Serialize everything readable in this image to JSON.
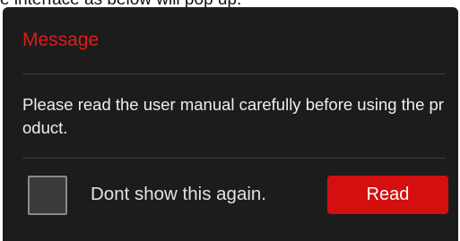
{
  "background_text": "e interface as below will pop up.",
  "dialog": {
    "title": "Message",
    "body": "Please read the user manual carefully before using the product.",
    "checkbox": {
      "label": "Dont show this again.",
      "checked": false
    },
    "read_button_label": "Read"
  },
  "colors": {
    "dialog_background": "#1c1c1c",
    "title": "#e11a1a",
    "button": "#d30f0f",
    "body_text": "#eeeeee"
  }
}
